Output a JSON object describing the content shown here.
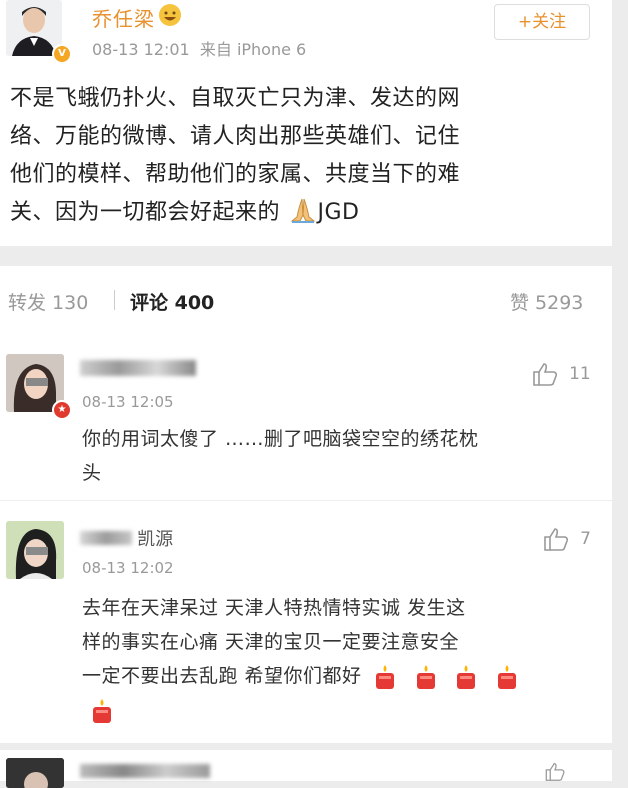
{
  "post": {
    "author": "乔任梁",
    "meta": "08-13 12:01  来自 iPhone 6",
    "follow_label": "+关注",
    "text_lines": [
      "不是飞蛾仍扑火、自取灭亡只为津、发达的网",
      "络、万能的微博、请人肉出那些英雄们、记住",
      "他们的模样、帮助他们的家属、共度当下的难",
      "关、因为一切都会好起来的"
    ],
    "text_end": "JGD",
    "icons": {
      "avatar": "avatar-icon",
      "verified": "verified-badge-icon",
      "emoji": "grin-emoji-icon",
      "pray": "pray-emoji-icon"
    }
  },
  "stats": {
    "repost": "转发 130",
    "comments": "评论 400",
    "likes": "赞 5293"
  },
  "comments": [
    {
      "time": "08-13 12:05",
      "likes": "11",
      "text_lines": [
        "你的用词太傻了 ……删了吧脑袋空空的绣花枕",
        "头"
      ]
    },
    {
      "name_visible": "凯源",
      "time": "08-13 12:02",
      "likes": "7",
      "text_lines": [
        "去年在天津呆过 天津人特热情特实诚 发生这",
        "样的事实在心痛 天津的宝贝一定要注意安全",
        "一定不要出去乱跑 希望你们都好"
      ],
      "emoji": "candle-emoji-icon"
    }
  ],
  "colors": {
    "background": "#ececec",
    "card": "#ffffff",
    "follow": "#e8912f",
    "badge": "#e03a2f",
    "name": "#e8912f"
  }
}
